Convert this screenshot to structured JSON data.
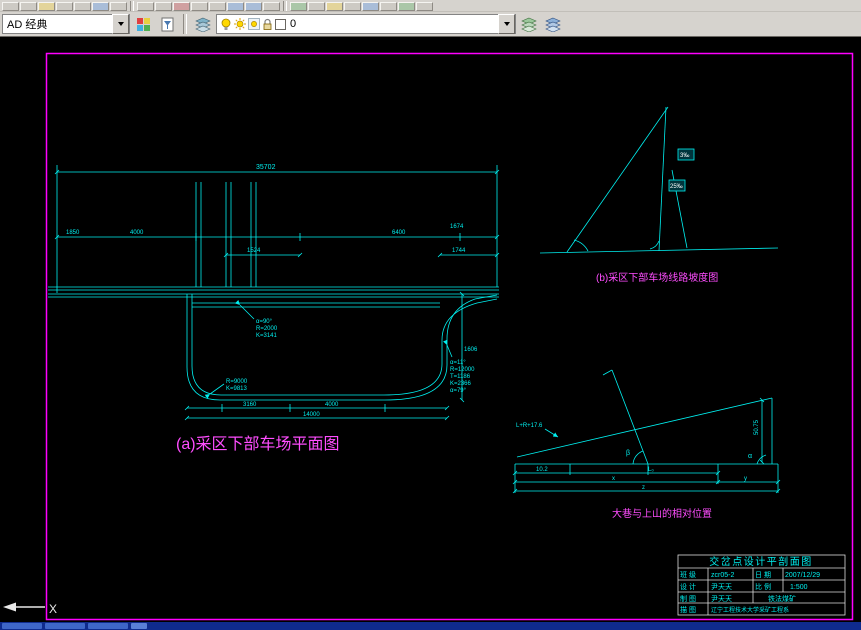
{
  "toolbar": {
    "workspace_value": "AD 经典",
    "layer_name": "0",
    "icons": [
      "lightbulb-icon",
      "sun-icon",
      "viewport-sun-icon",
      "lock-icon",
      "color-swatch-icon",
      "layers-stack-icon",
      "layer-properties-icon",
      "layer-states-icon"
    ]
  },
  "colors": {
    "frame_magenta": "#ff00ff",
    "draw_cyan": "#00f0f0",
    "label_magenta": "#ff4dff",
    "canvas_black": "#000000",
    "toolbar_gray": "#d6d3ce",
    "taskbar_blue": "#0f2b8e"
  },
  "plan": {
    "title": "(a)采区下部车场平面图",
    "dim_top": "35702",
    "dims": {
      "a": "1850",
      "b": "4000",
      "c": "1524",
      "d": "6400",
      "e": "1674",
      "f": "1744",
      "g": "1606",
      "h": "3160",
      "i": "4000",
      "j": "14000"
    },
    "curve1": [
      "α=90°",
      "R=2000",
      "K=3141"
    ],
    "curve2": [
      "R=9000",
      "K=9813"
    ],
    "curve3": [
      "α=11°",
      "R=12000",
      "T=1186",
      "K=2366",
      "α=79°"
    ]
  },
  "slope": {
    "title": "(b)采区下部车场线路坡度图",
    "marks": [
      "3‰",
      "25‰"
    ]
  },
  "relative": {
    "title": "大巷与上山的相对位置",
    "labels": {
      "lr": "L+R+17.6",
      "seg1": "10.2",
      "seg2": "L₀",
      "x": "x",
      "y": "y",
      "z": "z",
      "h": "50.75",
      "beta": "β",
      "alpha": "α"
    }
  },
  "titleblock": {
    "title": "交岔点设计平剖面图",
    "r1c1": "班 级",
    "r1c2": "zcr05-2",
    "r1c3": "日 期",
    "r1c4": "2007/12/29",
    "r2c1": "设 计",
    "r2c2": "尹天天",
    "r2c3": "比 例",
    "r2c4": "1:500",
    "r3c1": "制 图",
    "r3c2": "尹天天",
    "r3c4": "铁法煤矿",
    "r4c1": "描 图",
    "r4c2": "辽宁工程技术大学采矿工程系"
  },
  "ucs": {
    "x_label": "X"
  }
}
